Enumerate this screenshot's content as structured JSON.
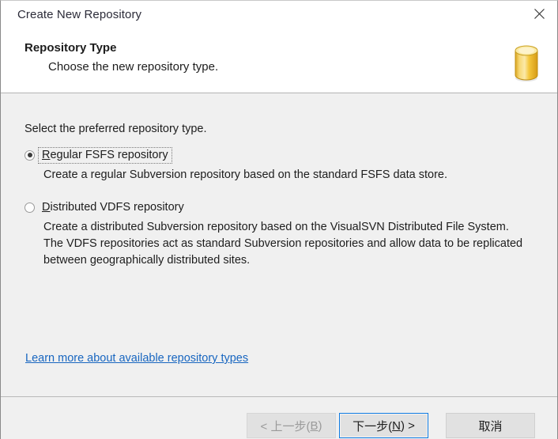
{
  "window": {
    "title": "Create New Repository",
    "close_icon": "close-icon"
  },
  "header": {
    "title": "Repository Type",
    "subtitle": "Choose the new repository type.",
    "icon": "repository-cylinder-icon",
    "icon_color": "#f0c33c"
  },
  "main": {
    "intro": "Select the preferred repository type.",
    "options": [
      {
        "label_prefix": "",
        "accel": "R",
        "label_rest": "egular FSFS repository",
        "label_full": "Regular FSFS repository",
        "description": "Create a regular Subversion repository based on the standard FSFS data store.",
        "selected": true,
        "focused": true
      },
      {
        "label_prefix": "",
        "accel": "D",
        "label_rest": "istributed VDFS repository",
        "label_full": "Distributed VDFS repository",
        "description": "Create a distributed Subversion repository based on the VisualSVN Distributed File System. The VDFS repositories act as standard Subversion repositories and allow data to be replicated between geographically distributed sites.",
        "selected": false,
        "focused": false
      }
    ],
    "learn_more_link": "Learn more about available repository types",
    "link_color": "#1866c0"
  },
  "footer": {
    "back_label_before": "< 上一步(",
    "back_accel": "B",
    "back_label_after": ")",
    "next_label_before": "下一步(",
    "next_accel": "N",
    "next_label_after": ") >",
    "cancel_label": "取消",
    "back_disabled": true,
    "next_is_default": true,
    "default_border_color": "#0f7ae0"
  }
}
